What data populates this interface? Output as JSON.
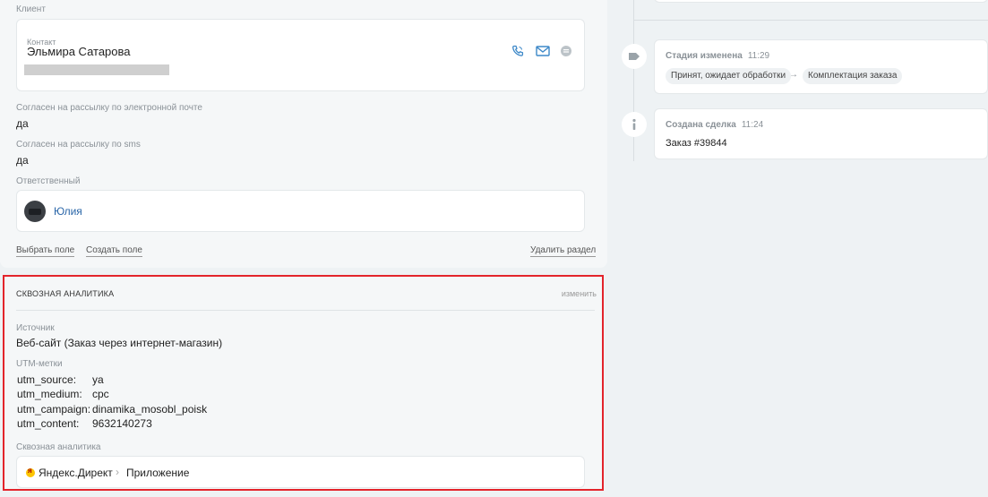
{
  "client": {
    "section_label": "Клиент",
    "contact_label": "Контакт",
    "contact_name": "Эльмира Сатарова",
    "icons": {
      "phone": "phone-icon",
      "mail": "mail-icon",
      "chat": "chat-icon"
    }
  },
  "fields": {
    "email_consent_label": "Согласен на рассылку по электронной почте",
    "email_consent_value": "да",
    "sms_consent_label": "Согласен на рассылку по sms",
    "sms_consent_value": "да",
    "owner_label": "Ответственный",
    "owner_name": "Юлия"
  },
  "actions": {
    "choose_field": "Выбрать поле",
    "create_field": "Создать поле",
    "delete_section": "Удалить раздел"
  },
  "analytics": {
    "title": "Сквозная аналитика",
    "edit": "изменить",
    "source_label": "Источник",
    "source_value": "Веб-сайт (Заказ через интернет-магазин)",
    "utm_label": "UTM-метки",
    "utm": [
      {
        "key": "utm_source:",
        "value": "ya"
      },
      {
        "key": "utm_medium:",
        "value": "cpc"
      },
      {
        "key": "utm_campaign:",
        "value": "dinamika_mosobl_poisk"
      },
      {
        "key": "utm_content:",
        "value": "9632140273"
      }
    ],
    "chain_label": "Сквозная аналитика",
    "chain": [
      "Яндекс.Директ",
      "Приложение"
    ]
  },
  "timeline": {
    "stage_changed": {
      "title": "Стадия изменена",
      "time": "11:29",
      "from": "Принят, ожидает обработки",
      "to": "Комплектация заказа"
    },
    "deal_created": {
      "title": "Создана сделка",
      "time": "11:24",
      "text": "Заказ #39844"
    }
  },
  "colors": {
    "accent_link": "#2a66a8",
    "highlight_border": "#e3242b",
    "icon_blue": "#3d88c8"
  }
}
